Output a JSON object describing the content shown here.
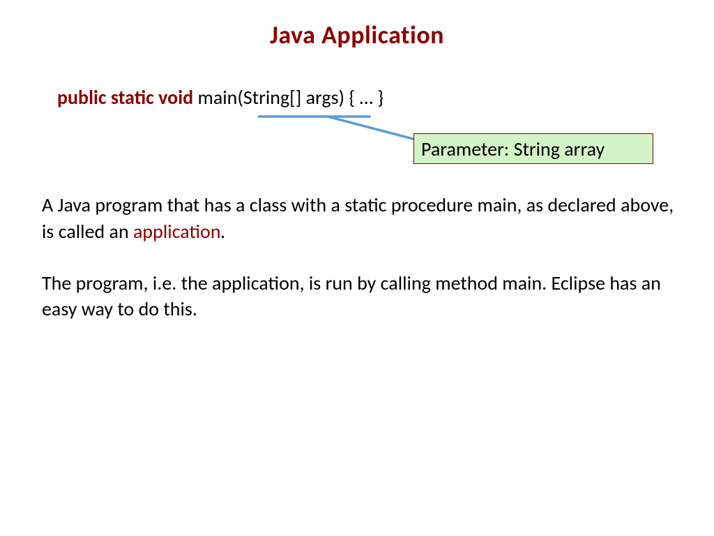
{
  "title": "Java Application",
  "code": {
    "keywords": "public static void",
    "signature": " main(String[] args) { … }"
  },
  "callout": "Parameter: String array",
  "para1_a": "A Java program that has a class with a static procedure main, as declared above, is called an ",
  "para1_app": "application",
  "para1_dot": ".",
  "para2": "The program, i.e. the application, is run by calling method main. Eclipse has an easy way to do this."
}
